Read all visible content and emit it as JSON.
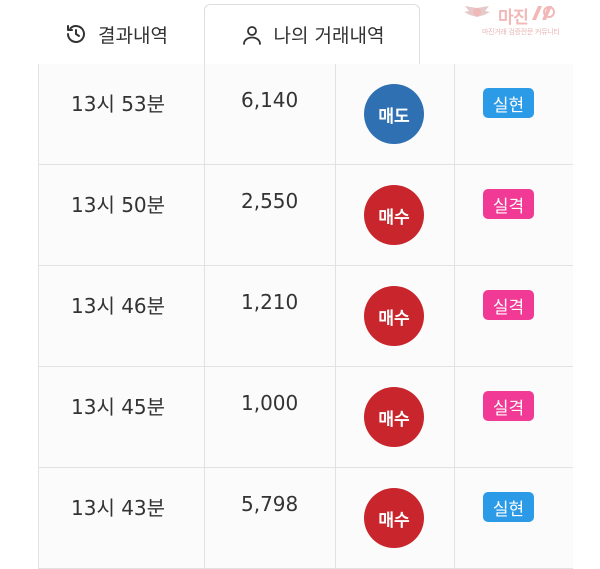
{
  "tabs": [
    {
      "label": "결과내역",
      "icon": "history-icon"
    },
    {
      "label": "나의 거래내역",
      "icon": "user-icon",
      "active": true
    }
  ],
  "watermark": {
    "title": "마진",
    "subtitle": "마진거래 검증전문 커뮤니티"
  },
  "colors": {
    "sell": "#2f70b3",
    "buy": "#c8262c",
    "realized": "#2b9be8",
    "failed": "#f03a95"
  },
  "trades": [
    {
      "time": "13시 53분",
      "amount": "6,140",
      "action": "매도",
      "action_type": "sell",
      "result": "실현",
      "result_type": "realized"
    },
    {
      "time": "13시 50분",
      "amount": "2,550",
      "action": "매수",
      "action_type": "buy",
      "result": "실격",
      "result_type": "failed"
    },
    {
      "time": "13시 46분",
      "amount": "1,210",
      "action": "매수",
      "action_type": "buy",
      "result": "실격",
      "result_type": "failed"
    },
    {
      "time": "13시 45분",
      "amount": "1,000",
      "action": "매수",
      "action_type": "buy",
      "result": "실격",
      "result_type": "failed"
    },
    {
      "time": "13시 43분",
      "amount": "5,798",
      "action": "매수",
      "action_type": "buy",
      "result": "실현",
      "result_type": "realized"
    }
  ]
}
